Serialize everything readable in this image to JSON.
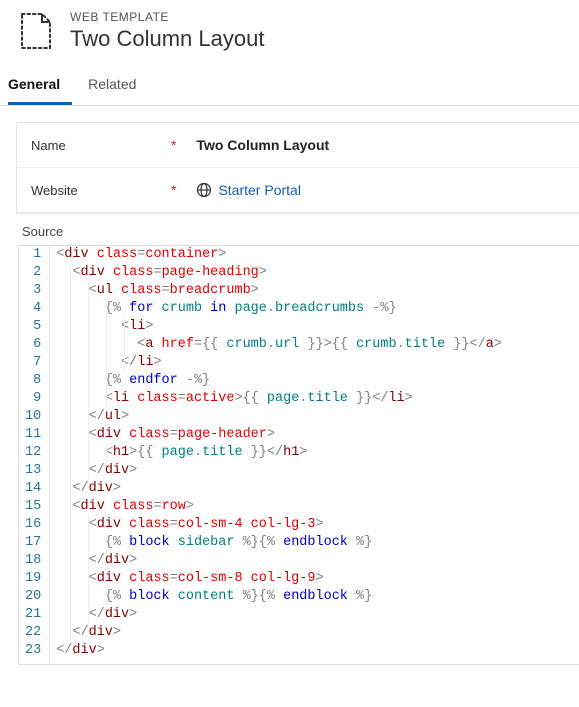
{
  "header": {
    "subtitle": "WEB TEMPLATE",
    "title": "Two Column Layout"
  },
  "tabs": {
    "general": "General",
    "related": "Related"
  },
  "form": {
    "name_label": "Name",
    "name_value": "Two Column Layout",
    "website_label": "Website",
    "website_value": "Starter Portal",
    "required_marker": "*"
  },
  "source": {
    "label": "Source",
    "lines": [
      {
        "n": 1,
        "indent": 0,
        "tokens": [
          [
            "punc",
            "<"
          ],
          [
            "tag",
            "div"
          ],
          [
            "txt",
            " "
          ],
          [
            "attr",
            "class"
          ],
          [
            "punc",
            "="
          ],
          [
            "val",
            "container"
          ],
          [
            "punc",
            ">"
          ]
        ]
      },
      {
        "n": 2,
        "indent": 1,
        "tokens": [
          [
            "punc",
            "<"
          ],
          [
            "tag",
            "div"
          ],
          [
            "txt",
            " "
          ],
          [
            "attr",
            "class"
          ],
          [
            "punc",
            "="
          ],
          [
            "val",
            "page-heading"
          ],
          [
            "punc",
            ">"
          ]
        ]
      },
      {
        "n": 3,
        "indent": 2,
        "tokens": [
          [
            "punc",
            "<"
          ],
          [
            "tag",
            "ul"
          ],
          [
            "txt",
            " "
          ],
          [
            "attr",
            "class"
          ],
          [
            "punc",
            "="
          ],
          [
            "val",
            "breadcrumb"
          ],
          [
            "punc",
            ">"
          ]
        ]
      },
      {
        "n": 4,
        "indent": 3,
        "tokens": [
          [
            "punc",
            "{% "
          ],
          [
            "liq",
            "for"
          ],
          [
            "txt",
            " "
          ],
          [
            "ident",
            "crumb"
          ],
          [
            "txt",
            " "
          ],
          [
            "liq",
            "in"
          ],
          [
            "txt",
            " "
          ],
          [
            "ident",
            "page"
          ],
          [
            "punc",
            "."
          ],
          [
            "prop",
            "breadcrumbs"
          ],
          [
            "txt",
            " "
          ],
          [
            "punc",
            "-"
          ],
          [
            "punc",
            "%}"
          ]
        ]
      },
      {
        "n": 5,
        "indent": 4,
        "tokens": [
          [
            "punc",
            "<"
          ],
          [
            "tag",
            "li"
          ],
          [
            "punc",
            ">"
          ]
        ]
      },
      {
        "n": 6,
        "indent": 5,
        "tokens": [
          [
            "punc",
            "<"
          ],
          [
            "tag",
            "a"
          ],
          [
            "txt",
            " "
          ],
          [
            "attr",
            "href"
          ],
          [
            "punc",
            "="
          ],
          [
            "punc",
            "{{ "
          ],
          [
            "ident",
            "crumb"
          ],
          [
            "punc",
            "."
          ],
          [
            "prop",
            "url"
          ],
          [
            "punc",
            " }}"
          ],
          [
            "punc",
            ">"
          ],
          [
            "punc",
            "{{ "
          ],
          [
            "ident",
            "crumb"
          ],
          [
            "punc",
            "."
          ],
          [
            "prop",
            "title"
          ],
          [
            "punc",
            " }}"
          ],
          [
            "punc",
            "</"
          ],
          [
            "tag",
            "a"
          ],
          [
            "punc",
            ">"
          ]
        ]
      },
      {
        "n": 7,
        "indent": 4,
        "tokens": [
          [
            "punc",
            "</"
          ],
          [
            "tag",
            "li"
          ],
          [
            "punc",
            ">"
          ]
        ]
      },
      {
        "n": 8,
        "indent": 3,
        "tokens": [
          [
            "punc",
            "{% "
          ],
          [
            "liq",
            "endfor"
          ],
          [
            "txt",
            " "
          ],
          [
            "punc",
            "-"
          ],
          [
            "punc",
            "%}"
          ]
        ]
      },
      {
        "n": 9,
        "indent": 3,
        "tokens": [
          [
            "punc",
            "<"
          ],
          [
            "tag",
            "li"
          ],
          [
            "txt",
            " "
          ],
          [
            "attr",
            "class"
          ],
          [
            "punc",
            "="
          ],
          [
            "val",
            "active"
          ],
          [
            "punc",
            ">"
          ],
          [
            "punc",
            "{{ "
          ],
          [
            "ident",
            "page"
          ],
          [
            "punc",
            "."
          ],
          [
            "prop",
            "title"
          ],
          [
            "punc",
            " }}"
          ],
          [
            "punc",
            "</"
          ],
          [
            "tag",
            "li"
          ],
          [
            "punc",
            ">"
          ]
        ]
      },
      {
        "n": 10,
        "indent": 2,
        "tokens": [
          [
            "punc",
            "</"
          ],
          [
            "tag",
            "ul"
          ],
          [
            "punc",
            ">"
          ]
        ]
      },
      {
        "n": 11,
        "indent": 2,
        "tokens": [
          [
            "punc",
            "<"
          ],
          [
            "tag",
            "div"
          ],
          [
            "txt",
            " "
          ],
          [
            "attr",
            "class"
          ],
          [
            "punc",
            "="
          ],
          [
            "val",
            "page-header"
          ],
          [
            "punc",
            ">"
          ]
        ]
      },
      {
        "n": 12,
        "indent": 3,
        "tokens": [
          [
            "punc",
            "<"
          ],
          [
            "tag",
            "h1"
          ],
          [
            "punc",
            ">"
          ],
          [
            "punc",
            "{{ "
          ],
          [
            "ident",
            "page"
          ],
          [
            "punc",
            "."
          ],
          [
            "prop",
            "title"
          ],
          [
            "punc",
            " }}"
          ],
          [
            "punc",
            "</"
          ],
          [
            "tag",
            "h1"
          ],
          [
            "punc",
            ">"
          ]
        ]
      },
      {
        "n": 13,
        "indent": 2,
        "tokens": [
          [
            "punc",
            "</"
          ],
          [
            "tag",
            "div"
          ],
          [
            "punc",
            ">"
          ]
        ]
      },
      {
        "n": 14,
        "indent": 1,
        "tokens": [
          [
            "punc",
            "</"
          ],
          [
            "tag",
            "div"
          ],
          [
            "punc",
            ">"
          ]
        ]
      },
      {
        "n": 15,
        "indent": 1,
        "tokens": [
          [
            "punc",
            "<"
          ],
          [
            "tag",
            "div"
          ],
          [
            "txt",
            " "
          ],
          [
            "attr",
            "class"
          ],
          [
            "punc",
            "="
          ],
          [
            "val",
            "row"
          ],
          [
            "punc",
            ">"
          ]
        ]
      },
      {
        "n": 16,
        "indent": 2,
        "tokens": [
          [
            "punc",
            "<"
          ],
          [
            "tag",
            "div"
          ],
          [
            "txt",
            " "
          ],
          [
            "attr",
            "class"
          ],
          [
            "punc",
            "="
          ],
          [
            "val",
            "col-sm-4 col-lg-3"
          ],
          [
            "punc",
            ">"
          ]
        ]
      },
      {
        "n": 17,
        "indent": 3,
        "tokens": [
          [
            "punc",
            "{% "
          ],
          [
            "liq",
            "block"
          ],
          [
            "txt",
            " "
          ],
          [
            "ident",
            "sidebar"
          ],
          [
            "txt",
            " "
          ],
          [
            "punc",
            "%}"
          ],
          [
            "punc",
            "{% "
          ],
          [
            "liq",
            "endblock"
          ],
          [
            "txt",
            " "
          ],
          [
            "punc",
            "%}"
          ]
        ]
      },
      {
        "n": 18,
        "indent": 2,
        "tokens": [
          [
            "punc",
            "</"
          ],
          [
            "tag",
            "div"
          ],
          [
            "punc",
            ">"
          ]
        ]
      },
      {
        "n": 19,
        "indent": 2,
        "tokens": [
          [
            "punc",
            "<"
          ],
          [
            "tag",
            "div"
          ],
          [
            "txt",
            " "
          ],
          [
            "attr",
            "class"
          ],
          [
            "punc",
            "="
          ],
          [
            "val",
            "col-sm-8 col-lg-9"
          ],
          [
            "punc",
            ">"
          ]
        ]
      },
      {
        "n": 20,
        "indent": 3,
        "tokens": [
          [
            "punc",
            "{% "
          ],
          [
            "liq",
            "block"
          ],
          [
            "txt",
            " "
          ],
          [
            "ident",
            "content"
          ],
          [
            "txt",
            " "
          ],
          [
            "punc",
            "%}"
          ],
          [
            "punc",
            "{% "
          ],
          [
            "liq",
            "endblock"
          ],
          [
            "txt",
            " "
          ],
          [
            "punc",
            "%}"
          ]
        ]
      },
      {
        "n": 21,
        "indent": 2,
        "tokens": [
          [
            "punc",
            "</"
          ],
          [
            "tag",
            "div"
          ],
          [
            "punc",
            ">"
          ]
        ]
      },
      {
        "n": 22,
        "indent": 1,
        "tokens": [
          [
            "punc",
            "</"
          ],
          [
            "tag",
            "div"
          ],
          [
            "punc",
            ">"
          ]
        ]
      },
      {
        "n": 23,
        "indent": 0,
        "tokens": [
          [
            "punc",
            "</"
          ],
          [
            "tag",
            "div"
          ],
          [
            "punc",
            ">"
          ]
        ]
      }
    ]
  }
}
